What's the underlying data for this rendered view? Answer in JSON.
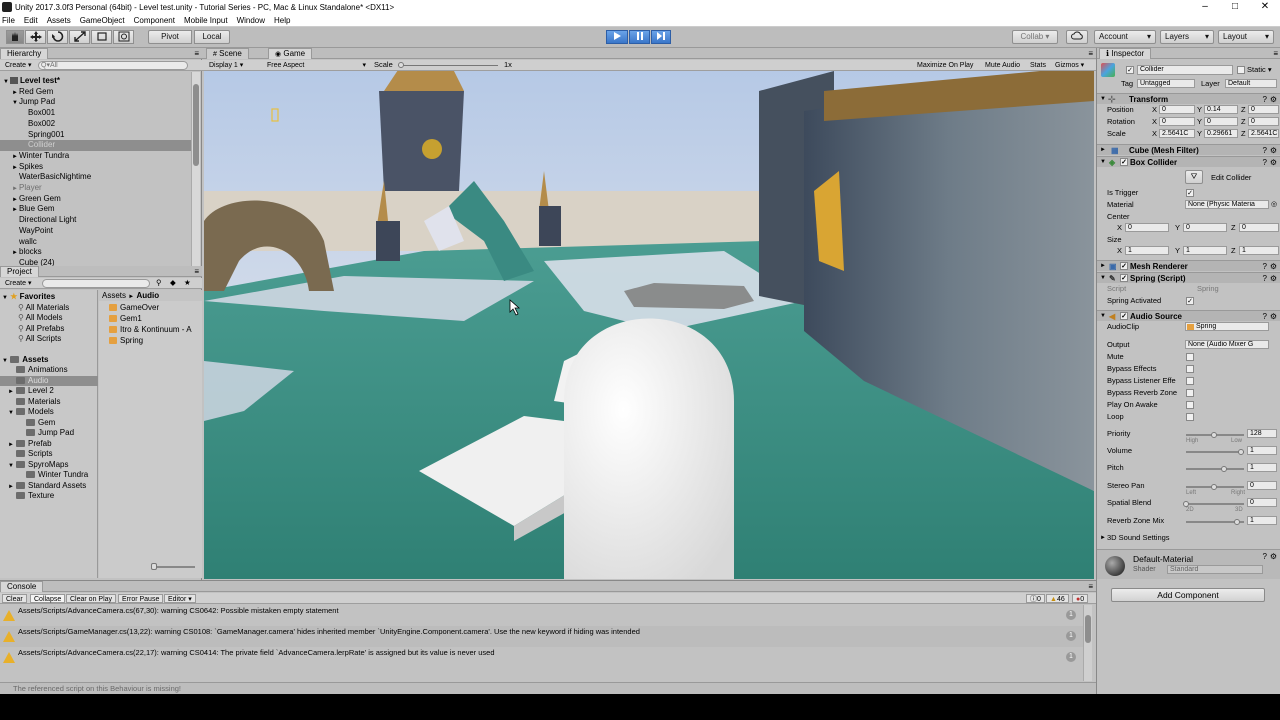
{
  "window": {
    "title": "Unity 2017.3.0f3 Personal (64bit) - Level test.unity - Tutorial Series - PC, Mac & Linux Standalone* <DX11>",
    "controls": [
      "–",
      "□",
      "✕"
    ]
  },
  "menu": [
    "File",
    "Edit",
    "Assets",
    "GameObject",
    "Component",
    "Mobile Input",
    "Window",
    "Help"
  ],
  "toolbar": {
    "pivot": "Pivot",
    "local": "Local",
    "collab": "Collab ▾",
    "account": "Account",
    "layers": "Layers",
    "layout": "Layout"
  },
  "hierarchy": {
    "tab": "Hierarchy",
    "create": "Create ▾",
    "search_placeholder": "Q▾All",
    "items": [
      {
        "label": "Level test*",
        "indent": 0,
        "tri": "▼",
        "bold": true
      },
      {
        "label": "Red Gem",
        "indent": 1,
        "tri": "►"
      },
      {
        "label": "Jump Pad",
        "indent": 1,
        "tri": "▼"
      },
      {
        "label": "Box001",
        "indent": 2,
        "tri": ""
      },
      {
        "label": "Box002",
        "indent": 2,
        "tri": ""
      },
      {
        "label": "Spring001",
        "indent": 2,
        "tri": ""
      },
      {
        "label": "Collider",
        "indent": 2,
        "tri": "",
        "selected": true
      },
      {
        "label": "Winter Tundra",
        "indent": 1,
        "tri": "►"
      },
      {
        "label": "Spikes",
        "indent": 1,
        "tri": "►"
      },
      {
        "label": "WaterBasicNightime",
        "indent": 1,
        "tri": ""
      },
      {
        "label": "Player",
        "indent": 1,
        "tri": "►",
        "disabled": true
      },
      {
        "label": "Green Gem",
        "indent": 1,
        "tri": "►"
      },
      {
        "label": "Blue Gem",
        "indent": 1,
        "tri": "►"
      },
      {
        "label": "Directional Light",
        "indent": 1,
        "tri": ""
      },
      {
        "label": "WayPoint",
        "indent": 1,
        "tri": ""
      },
      {
        "label": "wallc",
        "indent": 1,
        "tri": ""
      },
      {
        "label": "blocks",
        "indent": 1,
        "tri": "►"
      },
      {
        "label": "Cube (24)",
        "indent": 1,
        "tri": ""
      }
    ]
  },
  "project": {
    "tab": "Project",
    "create": "Create ▾",
    "favorites_label": "Favorites",
    "favorites": [
      "All Materials",
      "All Models",
      "All Prefabs",
      "All Scripts"
    ],
    "assets_label": "Assets",
    "assets_tree": [
      {
        "label": "Animations",
        "indent": 1,
        "tri": ""
      },
      {
        "label": "Audio",
        "indent": 1,
        "tri": "",
        "selected": true
      },
      {
        "label": "Level 2",
        "indent": 1,
        "tri": "►"
      },
      {
        "label": "Materials",
        "indent": 1,
        "tri": ""
      },
      {
        "label": "Models",
        "indent": 1,
        "tri": "▼"
      },
      {
        "label": "Gem",
        "indent": 2,
        "tri": ""
      },
      {
        "label": "Jump Pad",
        "indent": 2,
        "tri": ""
      },
      {
        "label": "Prefab",
        "indent": 1,
        "tri": "►"
      },
      {
        "label": "Scripts",
        "indent": 1,
        "tri": ""
      },
      {
        "label": "SpyroMaps",
        "indent": 1,
        "tri": "▼"
      },
      {
        "label": "Winter Tundra",
        "indent": 2,
        "tri": ""
      },
      {
        "label": "Standard Assets",
        "indent": 1,
        "tri": "►"
      },
      {
        "label": "Texture",
        "indent": 1,
        "tri": ""
      }
    ],
    "breadcrumb_root": "Assets",
    "breadcrumb_sep": "►",
    "breadcrumb_leaf": "Audio",
    "files": [
      "GameOver",
      "Gem1",
      "Itro & Kontinuum - A",
      "Spring"
    ]
  },
  "game_view": {
    "tabs": [
      "Scene",
      "Game"
    ],
    "display": "Display 1",
    "aspect": "Free Aspect",
    "scale_label": "Scale",
    "scale_value": "1x",
    "options": [
      "Maximize On Play",
      "Mute Audio",
      "Stats",
      "Gizmos ▾"
    ]
  },
  "inspector": {
    "tab": "Inspector",
    "object_name": "Collider",
    "static_label": "Static ▾",
    "tag_label": "Tag",
    "tag_value": "Untagged",
    "layer_label": "Layer",
    "layer_value": "Default",
    "transform": {
      "header": "Transform",
      "rows": [
        {
          "label": "Position",
          "x": "0",
          "y": "0.14",
          "z": "0"
        },
        {
          "label": "Rotation",
          "x": "0",
          "y": "0",
          "z": "0"
        },
        {
          "label": "Scale",
          "x": "2.5641C",
          "y": "0.29661",
          "z": "2.5641C"
        }
      ]
    },
    "mesh_filter": "Cube (Mesh Filter)",
    "box_collider": {
      "header": "Box Collider",
      "edit_label": "Edit Collider",
      "is_trigger": "Is Trigger",
      "material_label": "Material",
      "material_value": "None (Physic Materia",
      "center_label": "Center",
      "center": {
        "x": "0",
        "y": "0",
        "z": "0"
      },
      "size_label": "Size",
      "size": {
        "x": "1",
        "y": "1",
        "z": "1"
      }
    },
    "mesh_renderer": "Mesh Renderer",
    "spring_script": {
      "header": "Spring (Script)",
      "script_label": "Script",
      "script_value": "Spring",
      "activated_label": "Spring Activated"
    },
    "audio_source": {
      "header": "Audio Source",
      "clip_label": "AudioClip",
      "clip_value": "Spring",
      "output_label": "Output",
      "output_value": "None (Audio Mixer G",
      "toggles": [
        "Mute",
        "Bypass Effects",
        "Bypass Listener Effe",
        "Bypass Reverb Zone",
        "Play On Awake",
        "Loop"
      ],
      "priority_label": "Priority",
      "priority_value": "128",
      "high": "High",
      "low": "Low",
      "volume_label": "Volume",
      "volume_value": "1",
      "pitch_label": "Pitch",
      "pitch_value": "1",
      "stereo_label": "Stereo Pan",
      "stereo_value": "0",
      "left": "Left",
      "right": "Right",
      "spatial_label": "Spatial Blend",
      "spatial_value": "0",
      "d2": "2D",
      "d3": "3D",
      "reverb_label": "Reverb Zone Mix",
      "reverb_value": "1",
      "sound3d": "3D Sound Settings"
    },
    "material": {
      "name": "Default-Material",
      "shader_label": "Shader",
      "shader_value": "Standard"
    },
    "add_component": "Add Component"
  },
  "console": {
    "tab": "Console",
    "buttons": [
      "Clear",
      "Collapse",
      "Clear on Play",
      "Error Pause",
      "Editor ▾"
    ],
    "counts": [
      "0",
      "46",
      "0"
    ],
    "messages": [
      {
        "text": "Assets/Scripts/AdvanceCamera.cs(67,30): warning CS0642: Possible mistaken empty statement",
        "count": "1"
      },
      {
        "text": "Assets/Scripts/GameManager.cs(13,22): warning CS0108: `GameManager.camera' hides inherited member `UnityEngine.Component.camera'. Use the new keyword if hiding was intended",
        "count": "1"
      },
      {
        "text": "Assets/Scripts/AdvanceCamera.cs(22,17): warning CS0414: The private field `AdvanceCamera.lerpRate' is assigned but its value is never used",
        "count": "1"
      }
    ]
  },
  "status": "The referenced script on this Behaviour is missing!"
}
